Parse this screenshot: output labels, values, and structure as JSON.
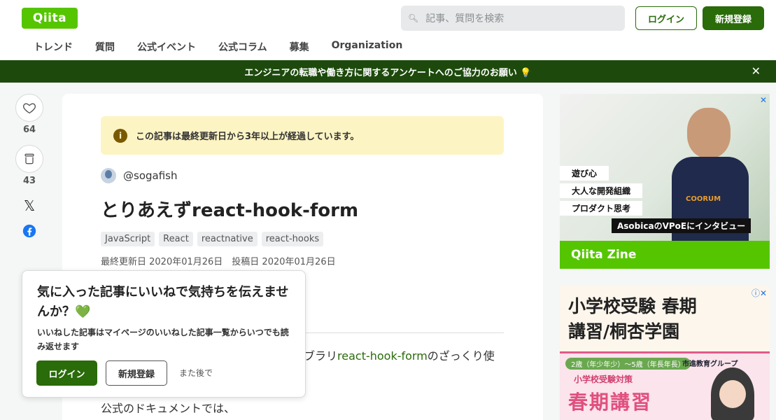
{
  "header": {
    "logo": "Qiita",
    "search_placeholder": "記事、質問を検索",
    "login": "ログイン",
    "signup": "新規登録"
  },
  "nav": [
    "トレンド",
    "質問",
    "公式イベント",
    "公式コラム",
    "募集",
    "Organization"
  ],
  "banner": {
    "text": "エンジニアの転職や働き方に関するアンケートへのご協力のお願い 💡",
    "close": "✕"
  },
  "sidebar": {
    "likes": "64",
    "stocks": "43"
  },
  "article": {
    "warning": "この記事は最終更新日から3年以上が経過しています。",
    "author": "@sogafish",
    "title": "とりあえずreact-hook-form",
    "tags": [
      "JavaScript",
      "React",
      "reactnative",
      "react-hooks"
    ],
    "dates": "最終更新日 2020年01月26日　投稿日 2020年01月26日",
    "body_prefix": "ブラリ",
    "body_link": "react-hook-form",
    "body_suffix": "のざっくり使",
    "body_line2": "公式のドキュメントでは、"
  },
  "popup": {
    "title": "気に入った記事にいいねで気持ちを伝えませんか？💚",
    "subtitle": "いいねした記事はマイページのいいねした記事一覧からいつでも読み返せます",
    "login": "ログイン",
    "signup": "新規登録",
    "later": "また後で"
  },
  "ad1": {
    "chips": [
      "遊び心",
      "大人な開発組織",
      "プロダクト思考"
    ],
    "caption": "AsobicaのVPoEにインタビュー",
    "footer": "Qiita Zine",
    "shirt_text": "COORUM"
  },
  "ad2": {
    "headline1": "小学校受験 春期",
    "headline2": "講習/桐杏学園",
    "age": "2歳（年少年少）～5歳（年長年長）",
    "brand": "市進教育グループ",
    "sub": "小学校受験対策",
    "big": "春期講習"
  }
}
